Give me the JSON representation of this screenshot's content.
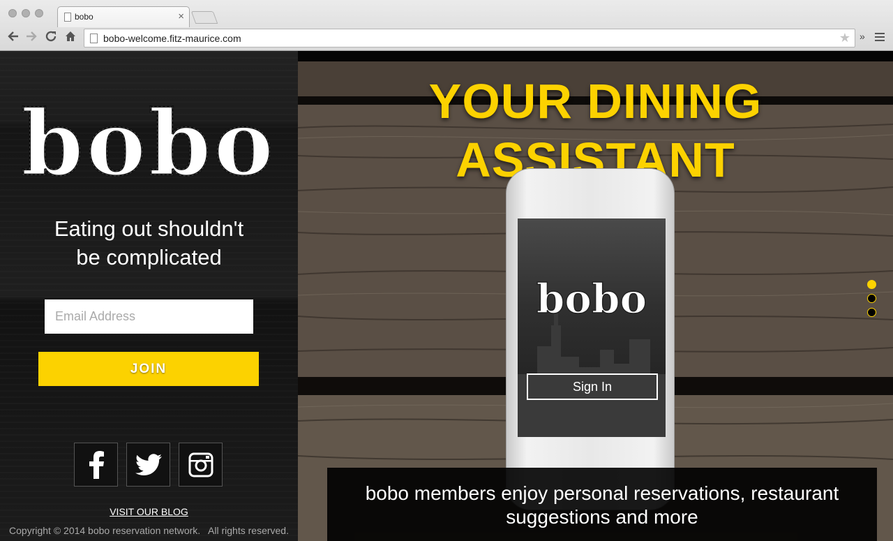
{
  "browser": {
    "tab_title": "bobo",
    "url": "bobo-welcome.fitz-maurice.com",
    "tab_close": "×",
    "overflow": "»"
  },
  "left": {
    "logo_text": "bobo",
    "tagline_line1": "Eating out shouldn't",
    "tagline_line2": "be complicated",
    "email_placeholder": "Email Address",
    "join_label": "JOIN",
    "social": [
      "facebook-icon",
      "twitter-icon",
      "instagram-icon"
    ],
    "blog_link": "VISIT OUR BLOG",
    "copyright": "Copyright © 2014 bobo reservation network.   All rights reserved."
  },
  "right": {
    "headline_line1": "YOUR DINING",
    "headline_line2": "ASSISTANT",
    "phone_logo": "bobo",
    "signin_label": "Sign In",
    "caption_line1": "bobo members enjoy personal reservations, restaurant",
    "caption_line2": "suggestions and more",
    "slider_dots": 3,
    "active_dot": 1
  },
  "colors": {
    "accent": "#fcd200",
    "panel": "#1a1a1a"
  }
}
